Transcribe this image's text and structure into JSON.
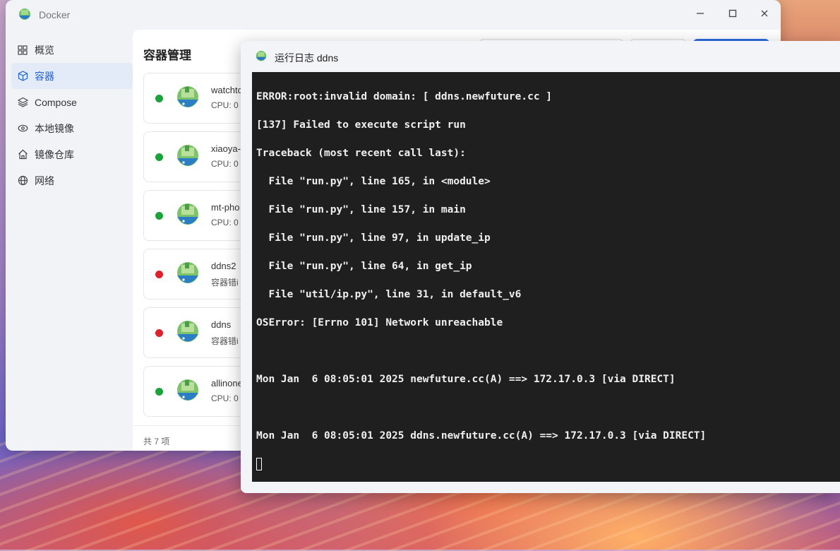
{
  "window": {
    "title": "Docker"
  },
  "sidebar": {
    "items": [
      {
        "label": "概览",
        "icon": "grid-icon"
      },
      {
        "label": "容器",
        "icon": "cube-icon",
        "active": true
      },
      {
        "label": "Compose",
        "icon": "layers-icon"
      },
      {
        "label": "本地镜像",
        "icon": "eye-icon"
      },
      {
        "label": "镜像仓库",
        "icon": "home-icon"
      },
      {
        "label": "网络",
        "icon": "globe-icon"
      }
    ]
  },
  "main": {
    "title": "容器管理",
    "containers": [
      {
        "name": "watchtc",
        "sub": "CPU: 0",
        "status": "running"
      },
      {
        "name": "xiaoya-",
        "sub": "CPU: 0",
        "status": "running"
      },
      {
        "name": "mt-pho",
        "sub": "CPU: 0",
        "status": "running"
      },
      {
        "name": "ddns2",
        "sub": "容器错i",
        "status": "error"
      },
      {
        "name": "ddns",
        "sub": "容器错i",
        "status": "error"
      },
      {
        "name": "allinone",
        "sub": "CPU: 0",
        "status": "running"
      }
    ],
    "footer": "共 7 项"
  },
  "colors": {
    "running": "#1aa33a",
    "error": "#e0202a",
    "accent": "#2d6ee0"
  },
  "log_window": {
    "title": "运行日志 ddns",
    "lines": [
      "ERROR:root:invalid domain: [ ddns.newfuture.cc ]",
      "[137] Failed to execute script run",
      "Traceback (most recent call last):",
      "  File \"run.py\", line 165, in <module>",
      "  File \"run.py\", line 157, in main",
      "  File \"run.py\", line 97, in update_ip",
      "  File \"run.py\", line 64, in get_ip",
      "  File \"util/ip.py\", line 31, in default_v6",
      "OSError: [Errno 101] Network unreachable",
      "",
      "Mon Jan  6 08:05:01 2025 newfuture.cc(A) ==> 172.17.0.3 [via DIRECT]",
      "",
      "Mon Jan  6 08:05:01 2025 ddns.newfuture.cc(A) ==> 172.17.0.3 [via DIRECT]"
    ]
  }
}
